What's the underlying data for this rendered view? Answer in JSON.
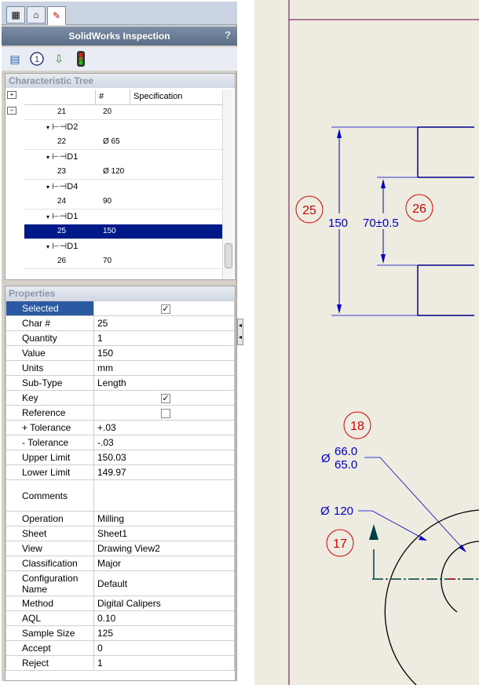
{
  "panel": {
    "title": "SolidWorks Inspection",
    "help_icon": "?",
    "tabs": [
      "feature-manager-icon",
      "property-manager-icon",
      "inspection-icon"
    ],
    "toolbar": [
      "add-characteristic-icon",
      "balloon-number-icon",
      "export-icon",
      "traffic-light-icon"
    ]
  },
  "tree": {
    "header": "Characteristic Tree",
    "columns": [
      "#",
      "Specification"
    ],
    "rows": [
      {
        "type": "item",
        "num": "21",
        "spec": "20"
      },
      {
        "type": "group",
        "label": "D2"
      },
      {
        "type": "item",
        "num": "22",
        "spec": "Ø  65"
      },
      {
        "type": "group",
        "label": "D1"
      },
      {
        "type": "item",
        "num": "23",
        "spec": "Ø  120"
      },
      {
        "type": "group",
        "label": "D4"
      },
      {
        "type": "item",
        "num": "24",
        "spec": "90"
      },
      {
        "type": "group",
        "label": "D1"
      },
      {
        "type": "item",
        "num": "25",
        "spec": "150",
        "selected": true
      },
      {
        "type": "group",
        "label": "D1"
      },
      {
        "type": "item",
        "num": "26",
        "spec": "70"
      }
    ]
  },
  "properties": {
    "header": "Properties",
    "rows": [
      {
        "key": "Selected",
        "value": "",
        "check": true,
        "checked": true,
        "highlight": true
      },
      {
        "key": "Char #",
        "value": "25"
      },
      {
        "key": "Quantity",
        "value": "1"
      },
      {
        "key": "Value",
        "value": "150"
      },
      {
        "key": "Units",
        "value": "mm"
      },
      {
        "key": "Sub-Type",
        "value": "Length"
      },
      {
        "key": "Key",
        "value": "",
        "check": true,
        "checked": true
      },
      {
        "key": "Reference",
        "value": "",
        "check": true,
        "checked": false
      },
      {
        "key": "+ Tolerance",
        "value": "+.03"
      },
      {
        "key": "- Tolerance",
        "value": "-.03"
      },
      {
        "key": "Upper Limit",
        "value": "150.03"
      },
      {
        "key": "Lower Limit",
        "value": "149.97"
      },
      {
        "key": "Comments",
        "value": "",
        "tall": true
      },
      {
        "key": "Operation",
        "value": "Milling"
      },
      {
        "key": "Sheet",
        "value": "Sheet1"
      },
      {
        "key": "View",
        "value": "Drawing View2"
      },
      {
        "key": "Classification",
        "value": "Major"
      },
      {
        "key": "Configuration Name",
        "value": "Default",
        "two": true
      },
      {
        "key": "Method",
        "value": "Digital Calipers"
      },
      {
        "key": "AQL",
        "value": "0.10"
      },
      {
        "key": "Sample Size",
        "value": "125"
      },
      {
        "key": "Accept",
        "value": "0"
      },
      {
        "key": "Reject",
        "value": "1"
      }
    ]
  },
  "drawing": {
    "balloons": [
      "25",
      "26",
      "18",
      "17"
    ],
    "dims": {
      "d150": "150",
      "d70": "70±0.5",
      "dia66": "66.0",
      "dia65": "65.0",
      "dia120": "120",
      "dia_symbol": "Ø"
    },
    "colors": {
      "balloon": "#d40000",
      "dimension": "#0000c8",
      "geometry": "#00008b",
      "background": "#eeebe0"
    }
  }
}
